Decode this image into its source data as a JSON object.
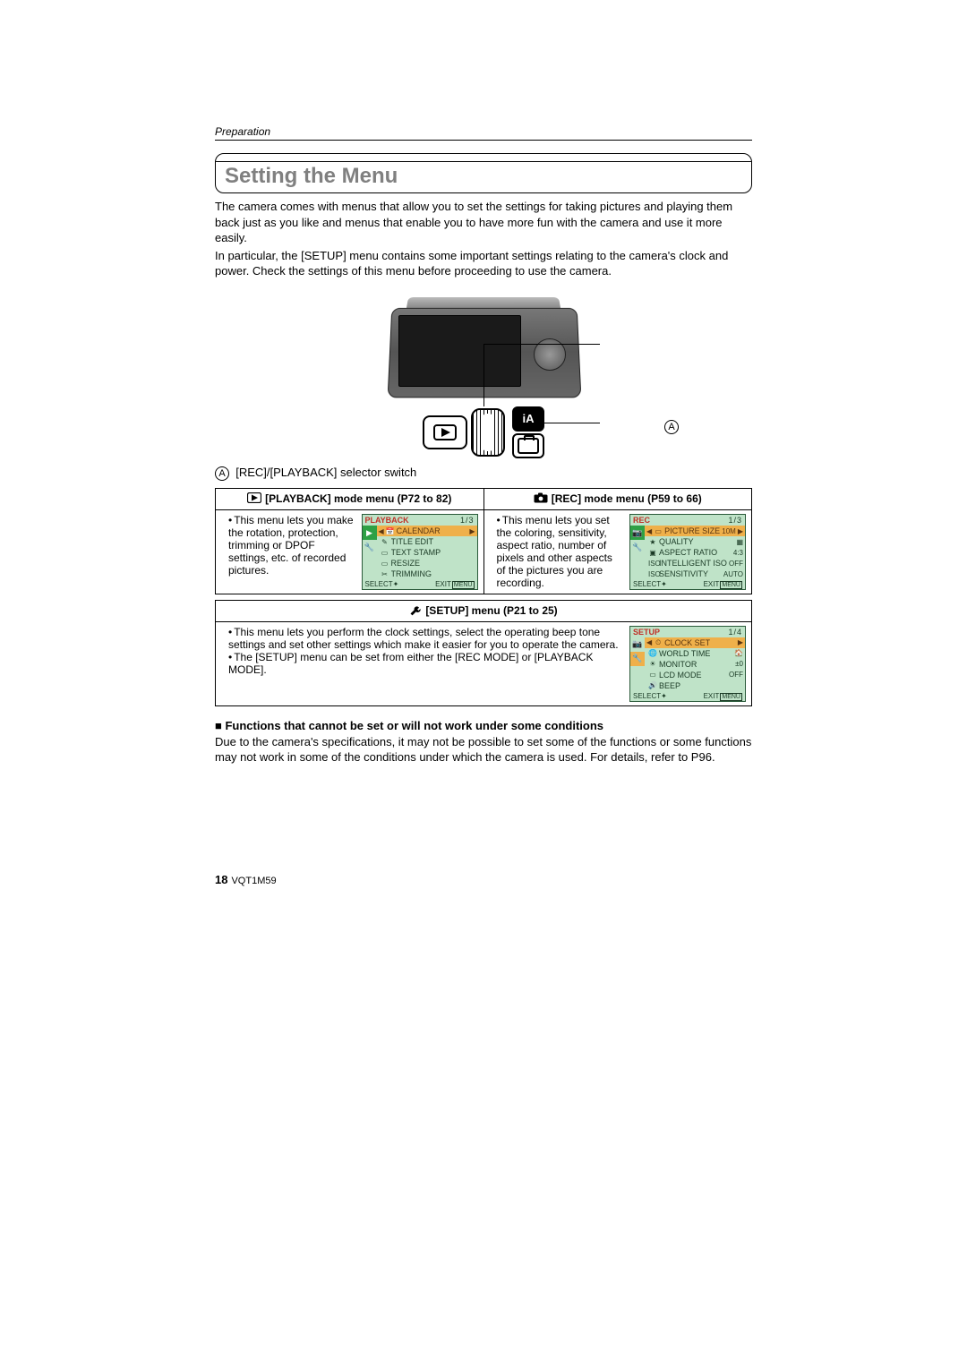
{
  "header": {
    "section": "Preparation"
  },
  "title": "Setting the Menu",
  "intro1": "The camera comes with menus that allow you to set the settings for taking pictures and playing them back just as you like and menus that enable you to have more fun with the camera and use it more easily.",
  "intro2": "In particular, the [SETUP] menu contains some important settings relating to the camera's clock and power. Check the settings of this menu before proceeding to use the camera.",
  "calloutA": "A",
  "switch_caption_prefix": "A",
  "switch_caption": "[REC]/[PLAYBACK] selector switch",
  "table": {
    "pb_header": "[PLAYBACK] mode menu (P72 to 82)",
    "rec_header": "[REC] mode menu (P59 to 66)",
    "pb_text": "This menu lets you make the rotation, protection, trimming or DPOF settings, etc. of recorded pictures.",
    "rec_text": "This menu lets you set the coloring, sensitivity, aspect ratio, number of pixels and other aspects of the pictures you are recording.",
    "setup_header": "[SETUP] menu (P21 to 25)",
    "setup_text1": "This menu lets you perform the clock settings, select the operating beep tone settings and set other settings which make it easier for you to operate the camera.",
    "setup_text2": "The [SETUP] menu can be set from either the [REC MODE] or [PLAYBACK MODE]."
  },
  "lcd_playback": {
    "title": "PLAYBACK",
    "page": "1/3",
    "items": [
      {
        "icon": "📅",
        "label": "CALENDAR",
        "sel": true
      },
      {
        "icon": "✎",
        "label": "TITLE EDIT"
      },
      {
        "icon": "▭",
        "label": "TEXT STAMP"
      },
      {
        "icon": "▭",
        "label": "RESIZE"
      },
      {
        "icon": "✂",
        "label": "TRIMMING"
      }
    ],
    "foot_select": "SELECT",
    "foot_exit": "EXIT"
  },
  "lcd_rec": {
    "title": "REC",
    "page": "1/3",
    "items": [
      {
        "icon": "▭",
        "label": "PICTURE SIZE",
        "val": "10M",
        "sel": true
      },
      {
        "icon": "★",
        "label": "QUALITY",
        "val": "▦"
      },
      {
        "icon": "▣",
        "label": "ASPECT RATIO",
        "val": "4:3"
      },
      {
        "icon": "ISO",
        "label": "INTELLIGENT ISO",
        "val": "OFF"
      },
      {
        "icon": "ISO",
        "label": "SENSITIVITY",
        "val": "AUTO"
      }
    ],
    "foot_select": "SELECT",
    "foot_exit": "EXIT"
  },
  "lcd_setup": {
    "title": "SETUP",
    "page": "1/4",
    "items": [
      {
        "icon": "⏲",
        "label": "CLOCK SET",
        "sel": true
      },
      {
        "icon": "🌐",
        "label": "WORLD TIME",
        "val": "🏠"
      },
      {
        "icon": "☀",
        "label": "MONITOR",
        "val": "±0"
      },
      {
        "icon": "▭",
        "label": "LCD MODE",
        "val": "OFF"
      },
      {
        "icon": "🔊",
        "label": "BEEP"
      }
    ],
    "foot_select": "SELECT",
    "foot_exit": "EXIT"
  },
  "functions_heading": "Functions that cannot be set or will not work under some conditions",
  "functions_body": "Due to the camera's specifications, it may not be possible to set some of the functions or some functions may not work in some of the conditions under which the camera is used. For details, refer to P96.",
  "footer": {
    "page": "18",
    "doc": "VQT1M59"
  }
}
